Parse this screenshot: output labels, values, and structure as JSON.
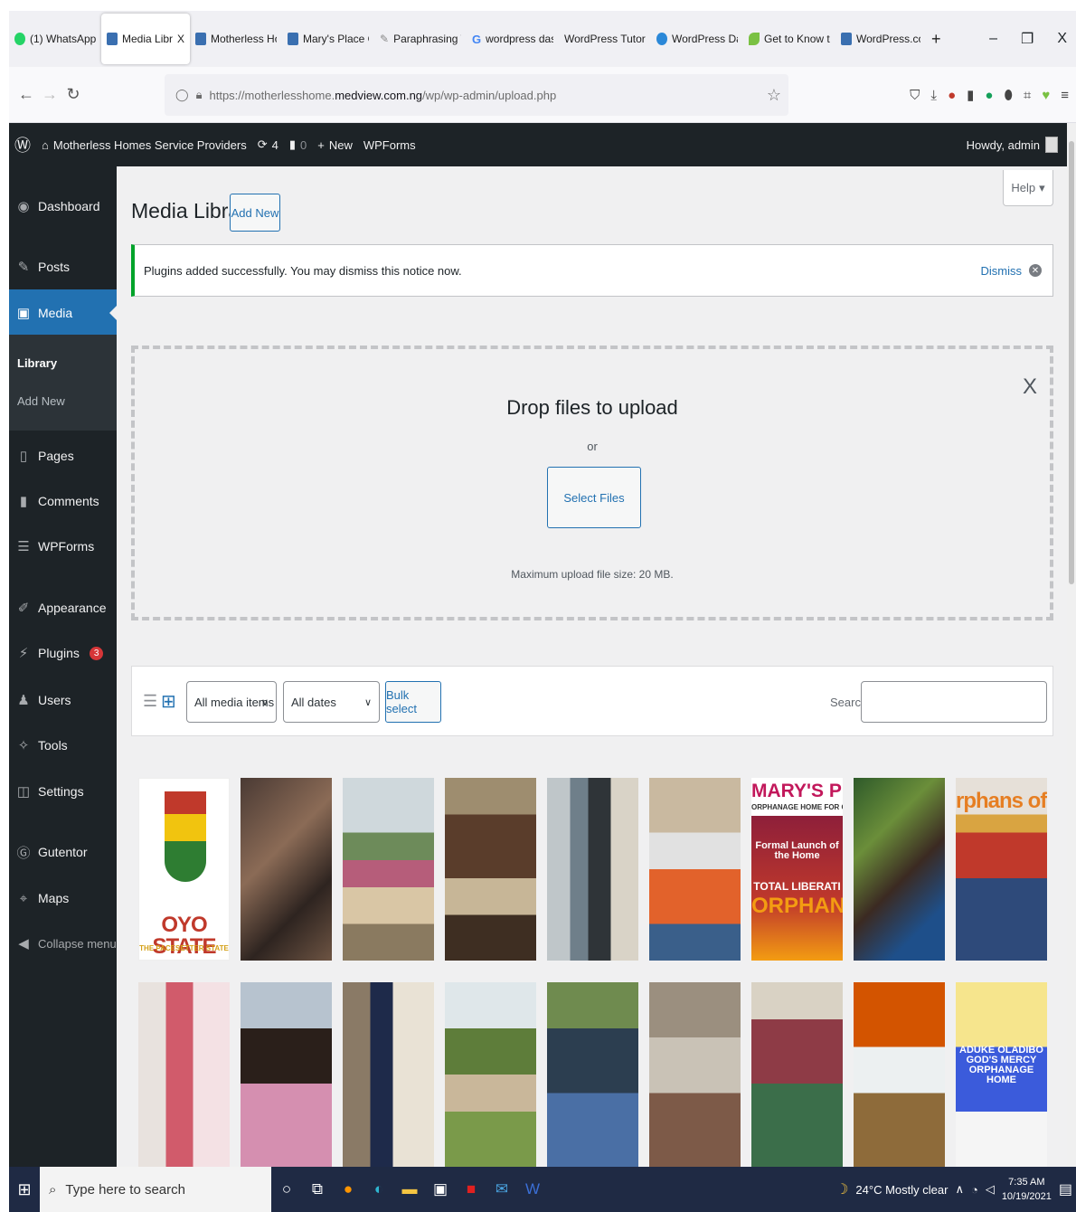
{
  "browser": {
    "tabs": [
      {
        "label": "(1) WhatsApp",
        "icon": "whatsapp-icon",
        "color": "#25d366"
      },
      {
        "label": "Media Library ‹",
        "icon": "site-icon",
        "color": "#3a6fb0",
        "active": true,
        "close": "X"
      },
      {
        "label": "Motherless Home",
        "icon": "site-icon",
        "color": "#3a6fb0"
      },
      {
        "label": "Mary's Place Orph",
        "icon": "site-icon",
        "color": "#3a6fb0"
      },
      {
        "label": "Paraphrasing Tool",
        "icon": "feather-icon",
        "color": "#888888"
      },
      {
        "label": "wordpress dashb",
        "icon": "google-icon",
        "color": "#4285f4"
      },
      {
        "label": "WordPress Tutorial - V",
        "icon": "none",
        "color": "#f0f0f4"
      },
      {
        "label": "WordPress Dashb",
        "icon": "edge-icon",
        "color": "#2b88d8"
      },
      {
        "label": "Get to Know the V",
        "icon": "leaf-icon",
        "color": "#7ac143"
      },
      {
        "label": "WordPress.com D",
        "icon": "wordpress-icon",
        "color": "#3a6fb0"
      }
    ],
    "new_tab": "+",
    "window_controls": {
      "minimize": "–",
      "restore": "❐",
      "close": "X"
    },
    "url_prefix": "https://motherlesshome.",
    "url_host": "medview.com.ng",
    "url_path": "/wp/wp-admin/upload.php"
  },
  "admin_bar": {
    "site_name": "Motherless Homes Service Providers",
    "updates": "4",
    "comments": "0",
    "new": "New",
    "wpforms": "WPForms",
    "howdy": "Howdy, admin"
  },
  "sidebar": {
    "dashboard": "Dashboard",
    "posts": "Posts",
    "media": "Media",
    "library": "Library",
    "add_new": "Add New",
    "pages": "Pages",
    "comments": "Comments",
    "wpforms": "WPForms",
    "appearance": "Appearance",
    "plugins": "Plugins",
    "plugins_badge": "3",
    "users": "Users",
    "tools": "Tools",
    "settings": "Settings",
    "gutentor": "Gutentor",
    "maps": "Maps",
    "collapse": "Collapse menu"
  },
  "main": {
    "help": "Help",
    "title": "Media Library",
    "add_new": "Add New",
    "notice": "Plugins added successfully. You may dismiss this notice now.",
    "dismiss": "Dismiss",
    "drop_title": "Drop files to upload",
    "or": "or",
    "select_files": "Select Files",
    "max_upload": "Maximum upload file size: 20 MB.",
    "close_uploader": "X",
    "filter_type": "All media items",
    "filter_date": "All dates",
    "bulk_select": "Bulk select",
    "search_label": "Search"
  },
  "media_grid": {
    "captions": {
      "oyo": "OYO STATE",
      "oyo_sub": "THE PACESETTER STATE",
      "marys": "MARY'S PLAC",
      "marys_sub": "ORPHANAGE HOME FOR GI",
      "marys_launch": "Formal Launch of the Home",
      "marys_total": "TOTAL LIBERATI",
      "marys_orph": "ORPHAN",
      "orphans_of_god": "rphans of Go",
      "aduke": "ADUKE OLADIBO GOD'S MERCY ORPHANAGE HOME"
    }
  },
  "taskbar": {
    "search_placeholder": "Type here to search",
    "weather": "24°C  Mostly clear",
    "time": "7:35 AM",
    "date": "10/19/2021"
  },
  "colors": {
    "admin_bg": "#1d2327",
    "accent": "#2271b1",
    "notice_success": "#00a32a",
    "badge": "#d63638"
  }
}
